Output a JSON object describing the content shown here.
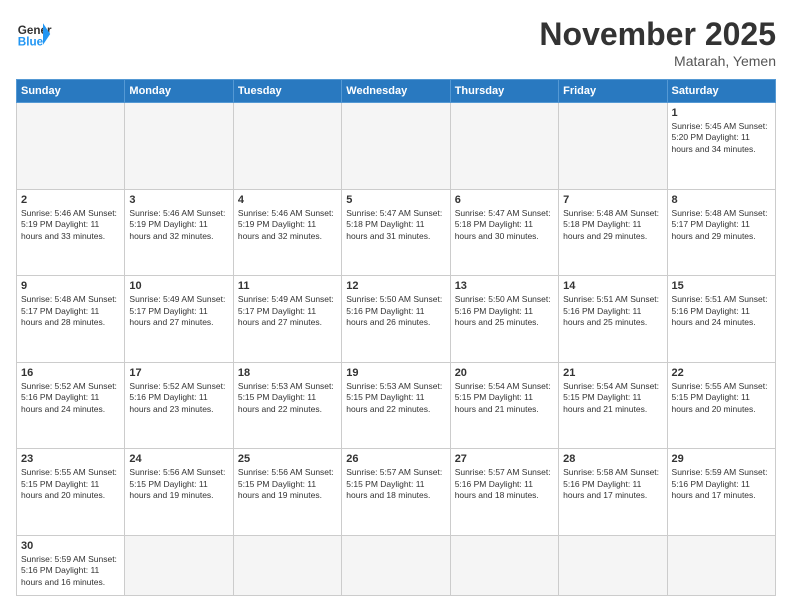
{
  "header": {
    "logo_general": "General",
    "logo_blue": "Blue",
    "month_title": "November 2025",
    "location": "Matarah, Yemen"
  },
  "weekdays": [
    "Sunday",
    "Monday",
    "Tuesday",
    "Wednesday",
    "Thursday",
    "Friday",
    "Saturday"
  ],
  "weeks": [
    [
      {
        "day": "",
        "info": ""
      },
      {
        "day": "",
        "info": ""
      },
      {
        "day": "",
        "info": ""
      },
      {
        "day": "",
        "info": ""
      },
      {
        "day": "",
        "info": ""
      },
      {
        "day": "",
        "info": ""
      },
      {
        "day": "1",
        "info": "Sunrise: 5:45 AM\nSunset: 5:20 PM\nDaylight: 11 hours and 34 minutes."
      }
    ],
    [
      {
        "day": "2",
        "info": "Sunrise: 5:46 AM\nSunset: 5:19 PM\nDaylight: 11 hours and 33 minutes."
      },
      {
        "day": "3",
        "info": "Sunrise: 5:46 AM\nSunset: 5:19 PM\nDaylight: 11 hours and 32 minutes."
      },
      {
        "day": "4",
        "info": "Sunrise: 5:46 AM\nSunset: 5:19 PM\nDaylight: 11 hours and 32 minutes."
      },
      {
        "day": "5",
        "info": "Sunrise: 5:47 AM\nSunset: 5:18 PM\nDaylight: 11 hours and 31 minutes."
      },
      {
        "day": "6",
        "info": "Sunrise: 5:47 AM\nSunset: 5:18 PM\nDaylight: 11 hours and 30 minutes."
      },
      {
        "day": "7",
        "info": "Sunrise: 5:48 AM\nSunset: 5:18 PM\nDaylight: 11 hours and 29 minutes."
      },
      {
        "day": "8",
        "info": "Sunrise: 5:48 AM\nSunset: 5:17 PM\nDaylight: 11 hours and 29 minutes."
      }
    ],
    [
      {
        "day": "9",
        "info": "Sunrise: 5:48 AM\nSunset: 5:17 PM\nDaylight: 11 hours and 28 minutes."
      },
      {
        "day": "10",
        "info": "Sunrise: 5:49 AM\nSunset: 5:17 PM\nDaylight: 11 hours and 27 minutes."
      },
      {
        "day": "11",
        "info": "Sunrise: 5:49 AM\nSunset: 5:17 PM\nDaylight: 11 hours and 27 minutes."
      },
      {
        "day": "12",
        "info": "Sunrise: 5:50 AM\nSunset: 5:16 PM\nDaylight: 11 hours and 26 minutes."
      },
      {
        "day": "13",
        "info": "Sunrise: 5:50 AM\nSunset: 5:16 PM\nDaylight: 11 hours and 25 minutes."
      },
      {
        "day": "14",
        "info": "Sunrise: 5:51 AM\nSunset: 5:16 PM\nDaylight: 11 hours and 25 minutes."
      },
      {
        "day": "15",
        "info": "Sunrise: 5:51 AM\nSunset: 5:16 PM\nDaylight: 11 hours and 24 minutes."
      }
    ],
    [
      {
        "day": "16",
        "info": "Sunrise: 5:52 AM\nSunset: 5:16 PM\nDaylight: 11 hours and 24 minutes."
      },
      {
        "day": "17",
        "info": "Sunrise: 5:52 AM\nSunset: 5:16 PM\nDaylight: 11 hours and 23 minutes."
      },
      {
        "day": "18",
        "info": "Sunrise: 5:53 AM\nSunset: 5:15 PM\nDaylight: 11 hours and 22 minutes."
      },
      {
        "day": "19",
        "info": "Sunrise: 5:53 AM\nSunset: 5:15 PM\nDaylight: 11 hours and 22 minutes."
      },
      {
        "day": "20",
        "info": "Sunrise: 5:54 AM\nSunset: 5:15 PM\nDaylight: 11 hours and 21 minutes."
      },
      {
        "day": "21",
        "info": "Sunrise: 5:54 AM\nSunset: 5:15 PM\nDaylight: 11 hours and 21 minutes."
      },
      {
        "day": "22",
        "info": "Sunrise: 5:55 AM\nSunset: 5:15 PM\nDaylight: 11 hours and 20 minutes."
      }
    ],
    [
      {
        "day": "23",
        "info": "Sunrise: 5:55 AM\nSunset: 5:15 PM\nDaylight: 11 hours and 20 minutes."
      },
      {
        "day": "24",
        "info": "Sunrise: 5:56 AM\nSunset: 5:15 PM\nDaylight: 11 hours and 19 minutes."
      },
      {
        "day": "25",
        "info": "Sunrise: 5:56 AM\nSunset: 5:15 PM\nDaylight: 11 hours and 19 minutes."
      },
      {
        "day": "26",
        "info": "Sunrise: 5:57 AM\nSunset: 5:15 PM\nDaylight: 11 hours and 18 minutes."
      },
      {
        "day": "27",
        "info": "Sunrise: 5:57 AM\nSunset: 5:16 PM\nDaylight: 11 hours and 18 minutes."
      },
      {
        "day": "28",
        "info": "Sunrise: 5:58 AM\nSunset: 5:16 PM\nDaylight: 11 hours and 17 minutes."
      },
      {
        "day": "29",
        "info": "Sunrise: 5:59 AM\nSunset: 5:16 PM\nDaylight: 11 hours and 17 minutes."
      }
    ],
    [
      {
        "day": "30",
        "info": "Sunrise: 5:59 AM\nSunset: 5:16 PM\nDaylight: 11 hours and 16 minutes."
      },
      {
        "day": "",
        "info": ""
      },
      {
        "day": "",
        "info": ""
      },
      {
        "day": "",
        "info": ""
      },
      {
        "day": "",
        "info": ""
      },
      {
        "day": "",
        "info": ""
      },
      {
        "day": "",
        "info": ""
      }
    ]
  ]
}
